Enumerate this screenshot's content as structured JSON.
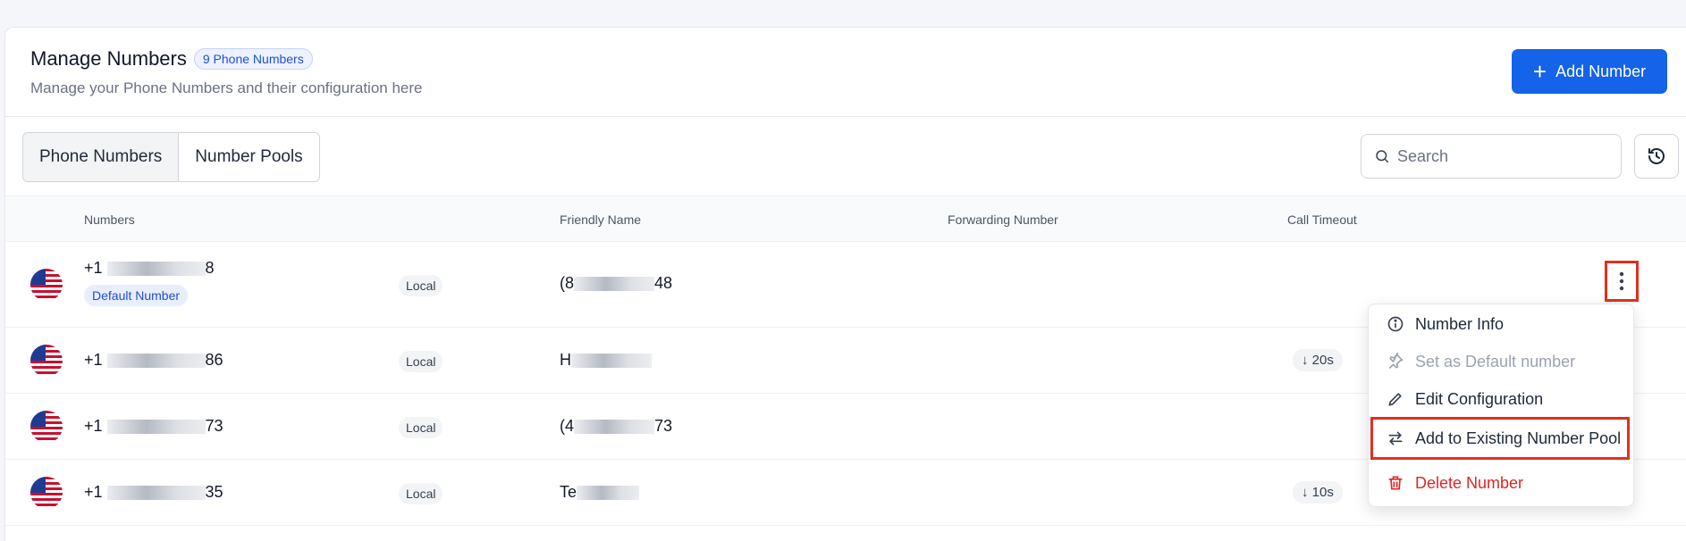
{
  "header": {
    "title": "Manage Numbers",
    "count_badge": "9 Phone Numbers",
    "subtitle": "Manage your Phone Numbers and their configuration here",
    "add_button": "Add Number"
  },
  "tabs": [
    {
      "label": "Phone Numbers",
      "active": true
    },
    {
      "label": "Number Pools",
      "active": false
    }
  ],
  "search": {
    "placeholder": "Search"
  },
  "table": {
    "columns": [
      "Numbers",
      "Friendly Name",
      "Forwarding Number",
      "Call Timeout"
    ],
    "rows": [
      {
        "number_prefix": "+1",
        "number_suffix": "8",
        "default_label": "Default Number",
        "type": "Local",
        "friendly_prefix": "(8",
        "friendly_suffix": "48",
        "timeout": ""
      },
      {
        "number_prefix": "+1",
        "number_suffix": "86",
        "default_label": "",
        "type": "Local",
        "friendly_prefix": "H",
        "friendly_suffix": "",
        "timeout": "20s"
      },
      {
        "number_prefix": "+1",
        "number_suffix": "73",
        "default_label": "",
        "type": "Local",
        "friendly_prefix": "(4",
        "friendly_suffix": "73",
        "timeout": ""
      },
      {
        "number_prefix": "+1",
        "number_suffix": "35",
        "default_label": "",
        "type": "Local",
        "friendly_prefix": "Te",
        "friendly_suffix": "",
        "timeout": "10s"
      }
    ]
  },
  "menu": {
    "items": [
      {
        "label": "Number Info",
        "icon": "info-icon"
      },
      {
        "label": "Set as Default number",
        "icon": "pin-icon"
      },
      {
        "label": "Edit Configuration",
        "icon": "pencil-icon"
      },
      {
        "label": "Add to Existing Number Pool",
        "icon": "arrows-swap-icon"
      },
      {
        "label": "Delete Number",
        "icon": "trash-icon"
      }
    ]
  },
  "colors": {
    "primary": "#1463e8",
    "danger": "#dc2626",
    "highlight_box": "#e0301e"
  }
}
